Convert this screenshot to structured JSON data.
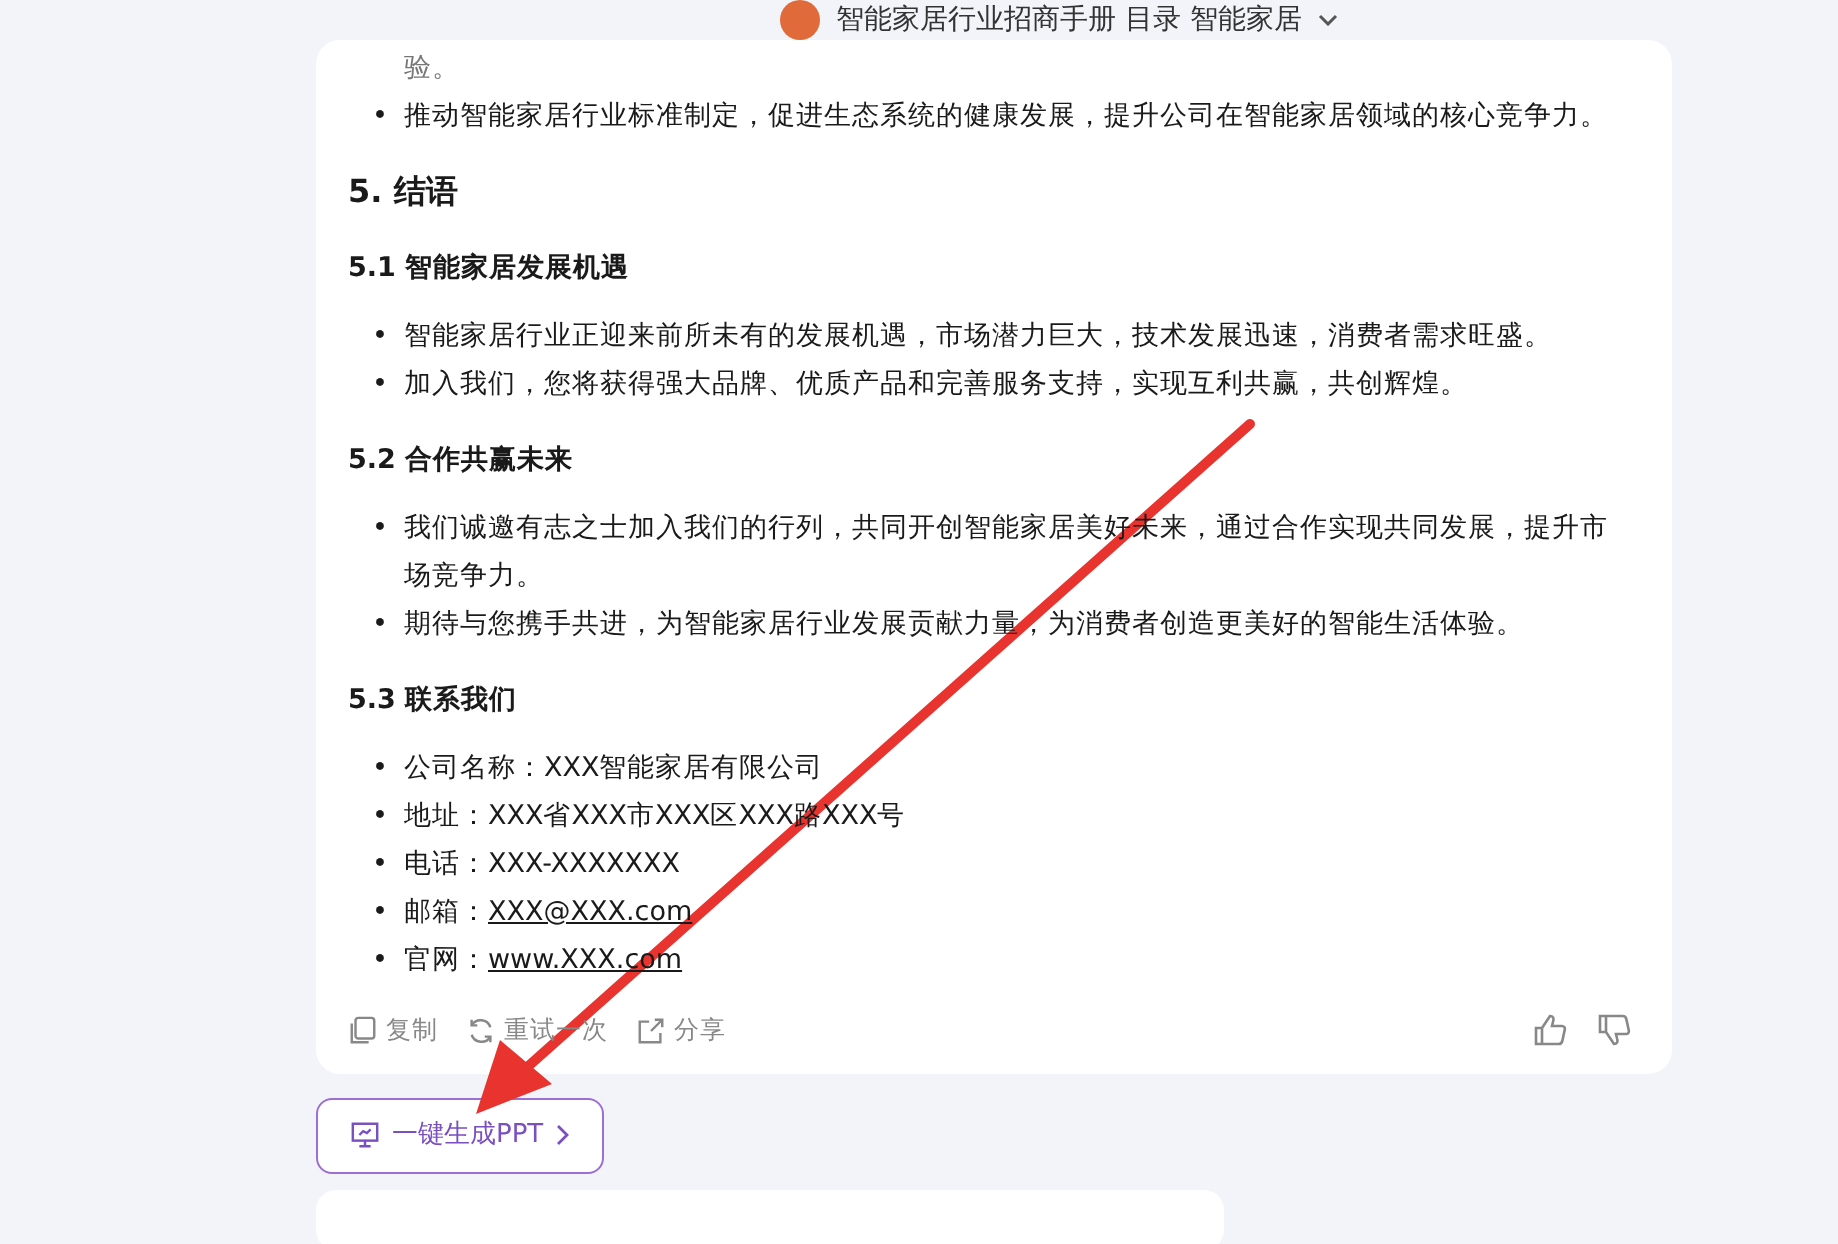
{
  "header": {
    "title": "智能家居行业招商手册 目录 智能家居"
  },
  "blocks": [
    {
      "kind": "continuation",
      "text": "验。"
    },
    {
      "kind": "bullets",
      "marker": "•",
      "items": [
        {
          "text": "推动智能家居行业标准制定，促进生态系统的健康发展，提升公司在智能家居领域的核心竞争力。"
        }
      ]
    },
    {
      "kind": "heading",
      "text": "5. 结语"
    },
    {
      "kind": "subheading",
      "text": "5.1 智能家居发展机遇"
    },
    {
      "kind": "bullets",
      "marker": "•",
      "items": [
        {
          "text": "智能家居行业正迎来前所未有的发展机遇，市场潜力巨大，技术发展迅速，消费者需求旺盛。"
        },
        {
          "text": "加入我们，您将获得强大品牌、优质产品和完善服务支持，实现互利共赢，共创辉煌。"
        }
      ]
    },
    {
      "kind": "subheading",
      "text": "5.2 合作共赢未来"
    },
    {
      "kind": "bullets",
      "marker": "•",
      "items": [
        {
          "text": "我们诚邀有志之士加入我们的行列，共同开创智能家居美好未来，通过合作实现共同发展，提升市场竞争力。"
        },
        {
          "text": "期待与您携手共进，为智能家居行业发展贡献力量，为消费者创造更美好的智能生活体验。"
        }
      ]
    },
    {
      "kind": "subheading",
      "text": "5.3 联系我们"
    },
    {
      "kind": "bullets",
      "marker": "•",
      "items": [
        {
          "label": "公司名称：",
          "value": "XXX智能家居有限公司",
          "link": false
        },
        {
          "label": "地址：",
          "value": "XXX省XXX市XXX区XXX路XXX号",
          "link": false
        },
        {
          "label": "电话：",
          "value": "XXX-XXXXXXX",
          "link": false
        },
        {
          "label": "邮箱：",
          "value": "XXX@XXX.com",
          "link": true
        },
        {
          "label": "官网：",
          "value": "www.XXX.com",
          "link": true
        }
      ]
    }
  ],
  "actions": [
    {
      "kind": "copy",
      "label": "复制"
    },
    {
      "kind": "retry",
      "label": "重试一次"
    },
    {
      "kind": "share",
      "label": "分享"
    }
  ],
  "ppt_button": {
    "label": "一键生成PPT"
  }
}
